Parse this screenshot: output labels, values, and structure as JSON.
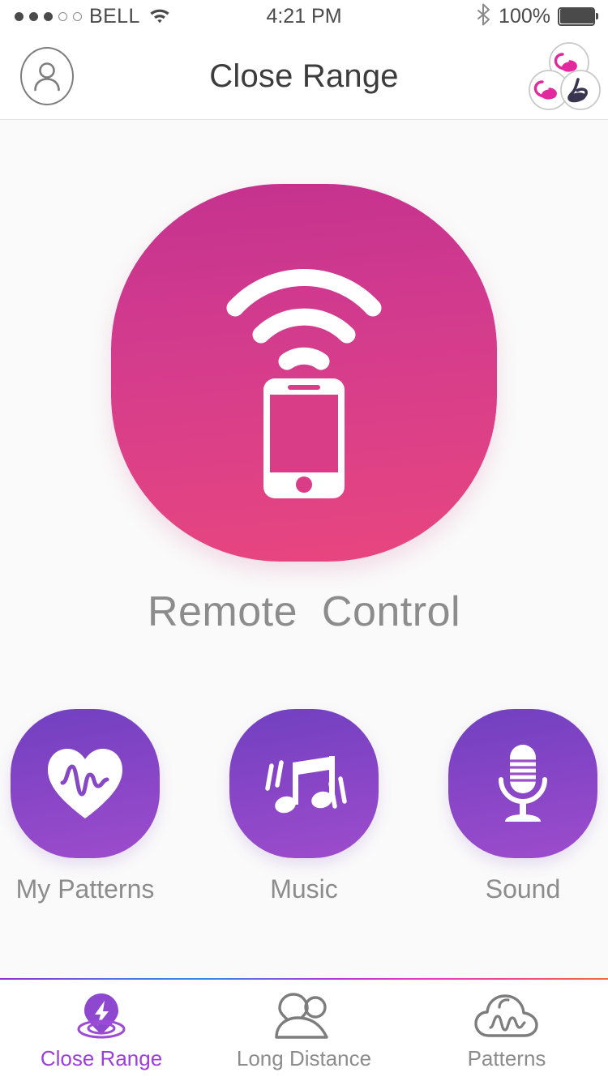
{
  "status_bar": {
    "signal_dots_filled": 3,
    "signal_dots_empty": 2,
    "carrier": "BELL",
    "wifi_icon": "wifi-icon",
    "time": "4:21 PM",
    "bluetooth_icon": "bluetooth-icon",
    "battery_percent": "100%",
    "battery_level": 100
  },
  "nav_bar": {
    "title": "Close Range",
    "avatar_icon": "person-icon",
    "devices_icon": "devices-cluster-icon",
    "devices": [
      {
        "name": "device-top",
        "color": "#e22a9e"
      },
      {
        "name": "device-bottom-left",
        "color": "#e22a9e"
      },
      {
        "name": "device-bottom-right",
        "color": "#39344f"
      }
    ]
  },
  "hero": {
    "label": "Remote  Control",
    "icon": "phone-wireless-icon",
    "gradient_top": "#c4328f",
    "gradient_bottom": "#e8467f"
  },
  "actions": [
    {
      "id": "my-patterns",
      "label": "My Patterns",
      "icon": "heart-pulse-icon"
    },
    {
      "id": "music",
      "label": "Music",
      "icon": "music-notes-icon"
    },
    {
      "id": "sound",
      "label": "Sound",
      "icon": "microphone-icon"
    }
  ],
  "action_gradient_top": "#7040c0",
  "action_gradient_bottom": "#9d4ccc",
  "tabs": [
    {
      "id": "close-range",
      "label": "Close Range",
      "icon": "location-pin-bolt-icon",
      "active": true
    },
    {
      "id": "long-distance",
      "label": "Long Distance",
      "icon": "two-people-icon",
      "active": false
    },
    {
      "id": "patterns",
      "label": "Patterns",
      "icon": "cloud-wave-icon",
      "active": false
    }
  ],
  "colors": {
    "accent_purple": "#9b3fd8",
    "accent_pink": "#e22a9e",
    "text_gray": "#8c8c8c",
    "title_gray": "#3c3c3c",
    "background": "#fafafa"
  }
}
